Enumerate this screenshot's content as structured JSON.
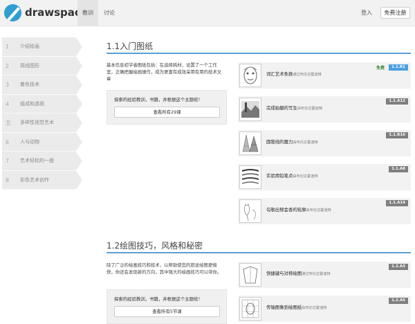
{
  "header": {
    "logo": "drawspace",
    "nav": [
      "教训",
      "讨论"
    ],
    "login": "登入",
    "signup": "免费注册"
  },
  "sidebar": {
    "items": [
      {
        "num": "1",
        "label": "介绍绘画"
      },
      {
        "num": "2",
        "label": "简线图形"
      },
      {
        "num": "3",
        "label": "着色技术"
      },
      {
        "num": "4",
        "label": "组成和透视"
      },
      {
        "num": "五",
        "label": "多样性视觉艺术"
      },
      {
        "num": "6",
        "label": "人与动物"
      },
      {
        "num": "7",
        "label": "艺术轻松的一面"
      },
      {
        "num": "8",
        "label": "彩色艺术创作"
      }
    ]
  },
  "sections": [
    {
      "title": "1.1入门图纸",
      "intro": "基本信息初学者图纸包括：在选择耗材，设置了一个工作室，正确把握绘画操作，成为更富有成效采用有用的技术文章",
      "cta_text": "探索的经验教训，书籍，并根据这个主题班！",
      "cta_button": "查看所有29课"
    },
    {
      "title": "1.2绘图技巧，风格和秘密",
      "intro": "除了广泛的绘画技巧和技术，以帮助使您的旅途绘图更愉快，你还会发现新的方向，其中强大的绘画技巧可以带你。",
      "cta_text": "探索的经验教训，书籍，并根据这个主题班！",
      "cta_button": "查看所有5节课"
    }
  ],
  "lessons": [
    {
      "title": "词汇艺术条款",
      "author": "通过布伦达霍迪特",
      "badge": "1.1.R1",
      "free": "免费",
      "icon": "face-sketch-icon"
    },
    {
      "title": "完成拍摄的写生",
      "author": "由布伦达霍迪特",
      "badge": "1.1.A12",
      "icon": "landscape-sketch-icon"
    },
    {
      "title": "圆锥线的魔力",
      "author": "由布伦达霍迪特",
      "badge": "1.1.R16",
      "icon": "cone-lines-icon"
    },
    {
      "title": "实验用铅笔点",
      "author": "由布伦达霍迪特",
      "badge": "1.1.A8",
      "icon": "pencil-strokes-icon"
    },
    {
      "title": "勾勒出郁金香的轮廓",
      "author": "由布伦达霍迪特",
      "badge": "1.1.A14",
      "icon": "tulip-icon"
    },
    {
      "title": "快捷键与对称绘图",
      "author": "通过布伦达霍迪特",
      "badge": "1.2.A3",
      "icon": "symmetry-icon"
    },
    {
      "title": "传输图像到绘图纸",
      "author": "由布伦达霍迪特",
      "badge": "1.2.A5",
      "icon": "portrait-grid-icon"
    }
  ]
}
